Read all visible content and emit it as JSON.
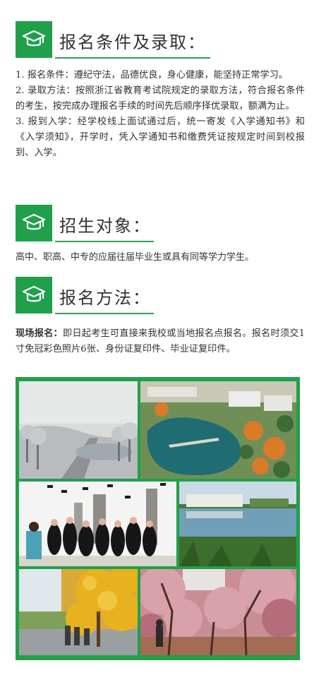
{
  "sections": [
    {
      "title": "报名条件及录取：",
      "icon": "graduation-cap-icon"
    },
    {
      "title": "招生对象：",
      "icon": "graduation-cap-icon"
    },
    {
      "title": "报名方法：",
      "icon": "graduation-cap-icon"
    }
  ],
  "enroll_conditions": [
    "1. 报名条件：遵纪守法，品德优良，身心健康，能坚持正常学习。",
    "2. 录取方法：按照浙江省教育考试院规定的录取方法，符合报名条件的考生，按完成办理报名手续的时间先后顺序择优录取，额满为止。",
    "3. 报到入学：经学校线上面试通过后，统一寄发《入学通知书》和《入学须知》，开学时，凭入学通知书和缴费凭证按规定时间到校报到、入学。"
  ],
  "target_text": "高中、职高、中专的应届往届毕业生或具有同等学力学生。",
  "method": {
    "label": "现场报名：",
    "text": "即日起考生可直接来我校或当地报名点报名。报名时须交1寸免冠彩色照片6张、身份证复印件、毕业证复印件。"
  },
  "photos": [
    "snowy-campus-photo",
    "aerial-lake-bridge-photo",
    "graduation-celebration-photo",
    "lakeside-building-photo",
    "ginkgo-autumn-photo",
    "cherry-blossom-photo"
  ],
  "colors": {
    "accent": "#21a04b",
    "text": "#333333"
  }
}
